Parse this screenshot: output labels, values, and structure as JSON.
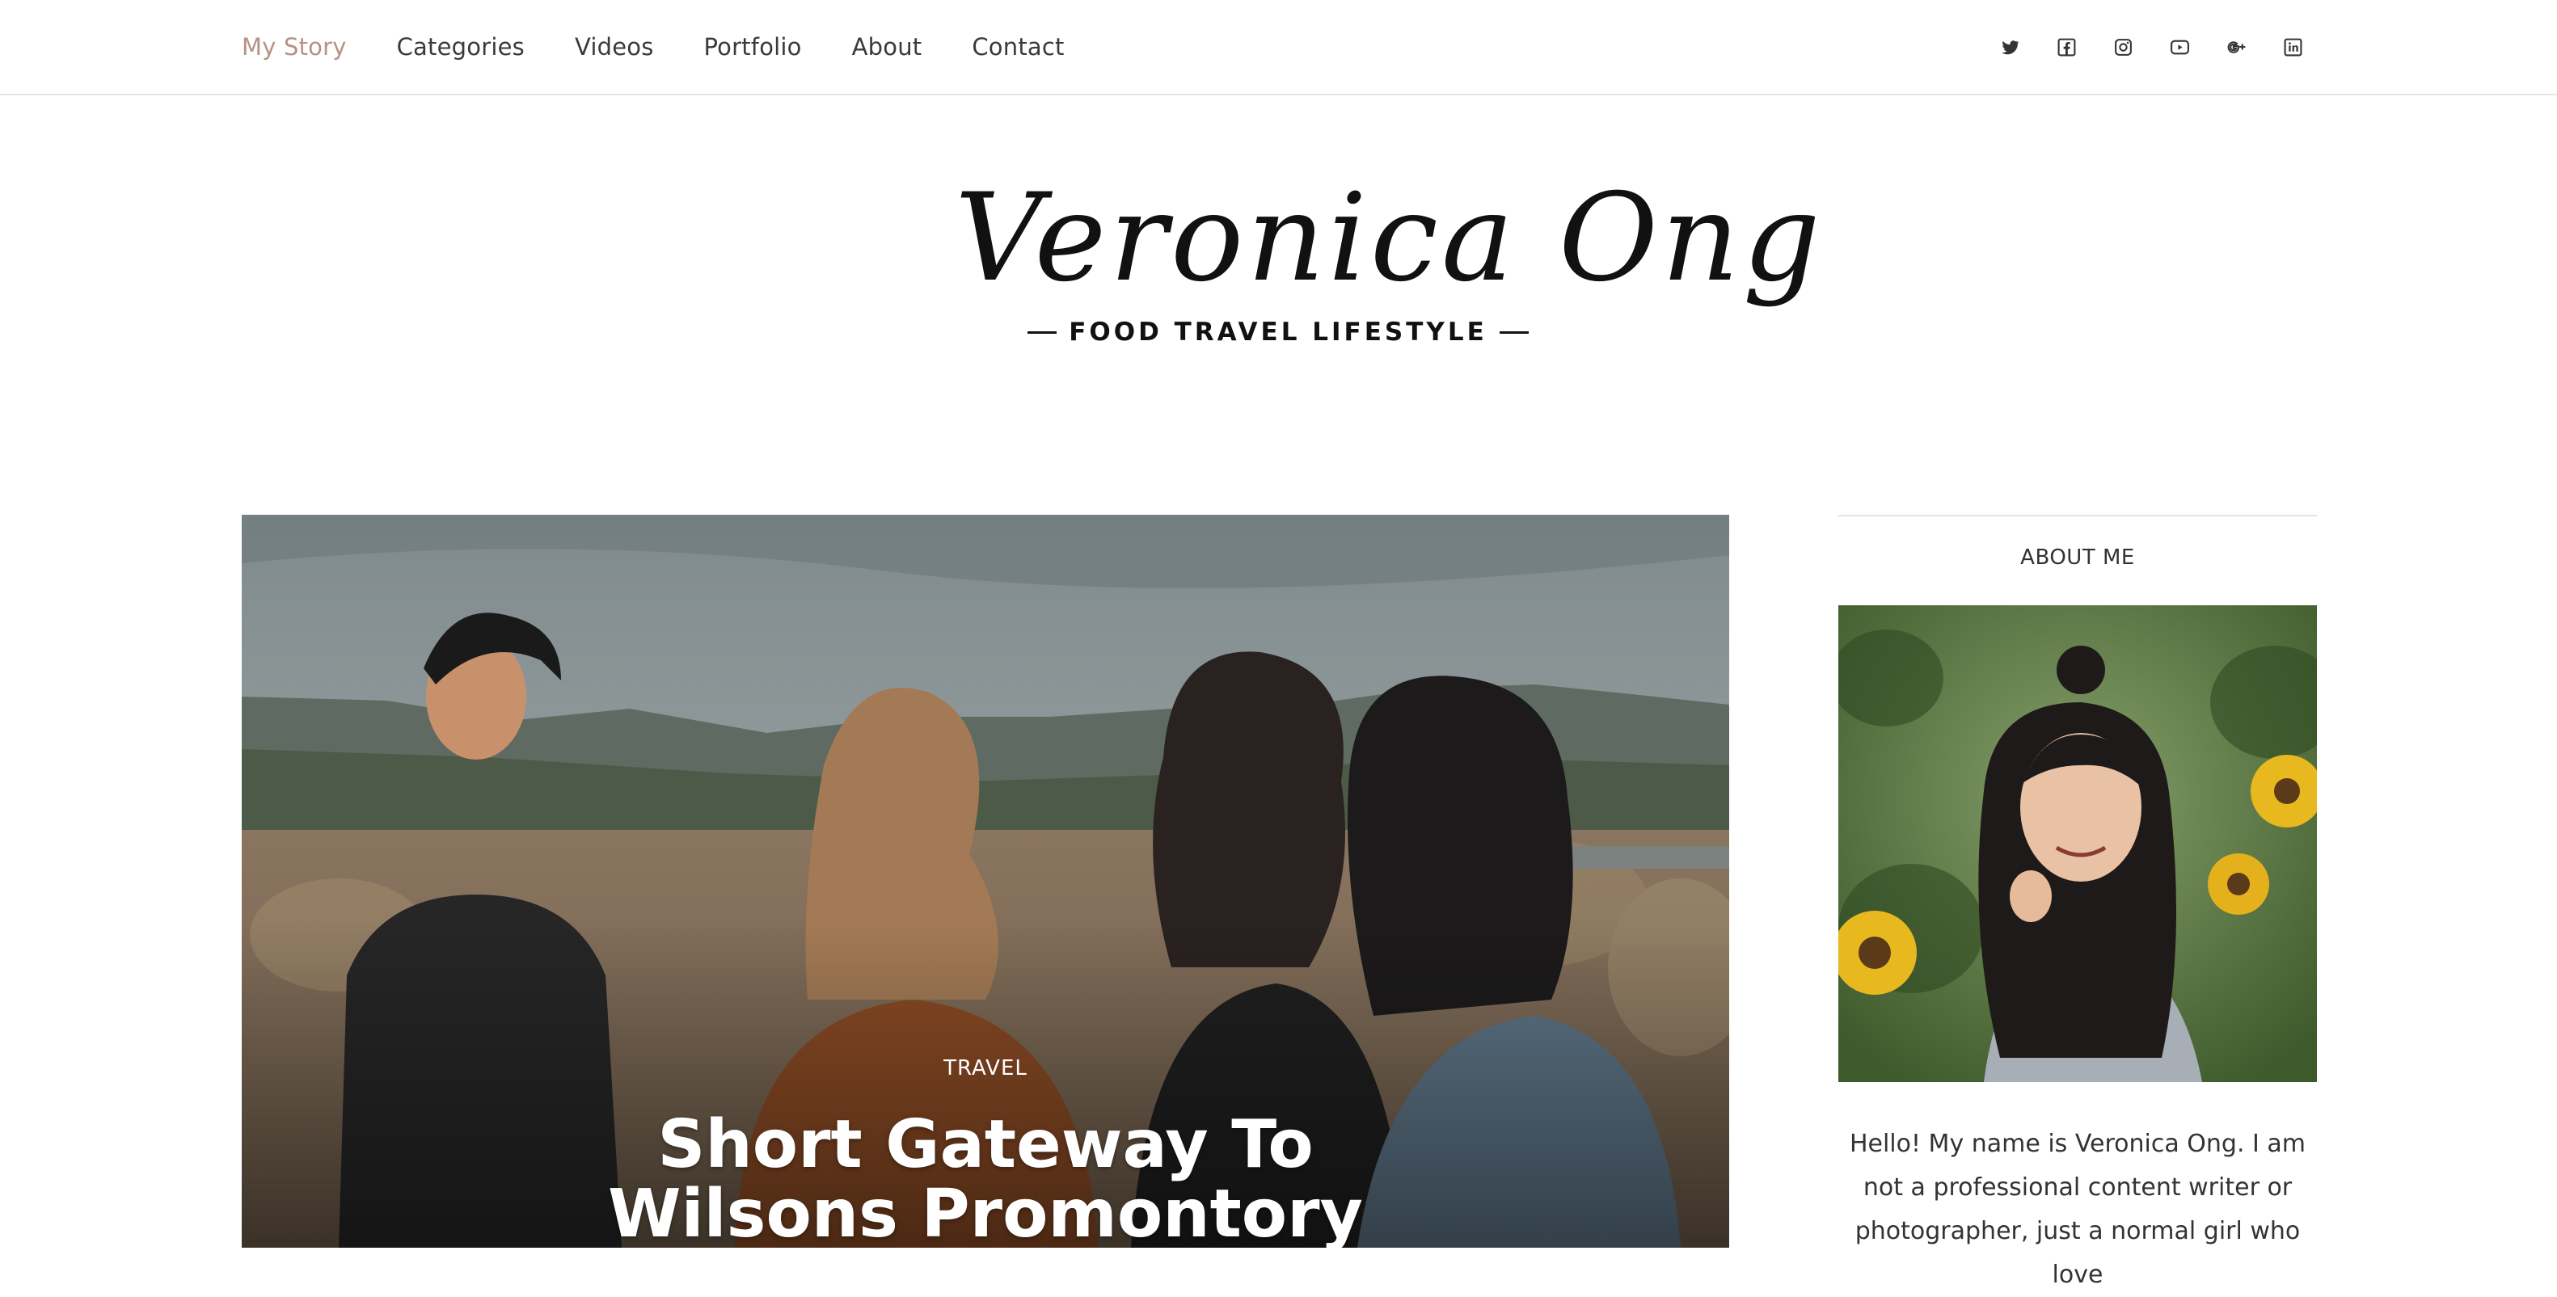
{
  "nav": {
    "items": [
      {
        "label": "My Story",
        "active": true
      },
      {
        "label": "Categories",
        "active": false
      },
      {
        "label": "Videos",
        "active": false
      },
      {
        "label": "Portfolio",
        "active": false
      },
      {
        "label": "About",
        "active": false
      },
      {
        "label": "Contact",
        "active": false
      }
    ],
    "active_color": "#b59286"
  },
  "social": [
    "twitter-icon",
    "facebook-icon",
    "instagram-icon",
    "youtube-icon",
    "google-plus-icon",
    "linkedin-icon"
  ],
  "logo": {
    "name": "Veronica Ong",
    "tagline": "FOOD TRAVEL LIFESTYLE"
  },
  "featured_post": {
    "category": "TRAVEL",
    "title": "Short Gateway To Wilsons Promontory National Park"
  },
  "sidebar": {
    "widget_title": "ABOUT ME",
    "about_text": "Hello! My name is Veronica Ong. I am not a professional content writer or photographer, just a normal girl who love"
  }
}
